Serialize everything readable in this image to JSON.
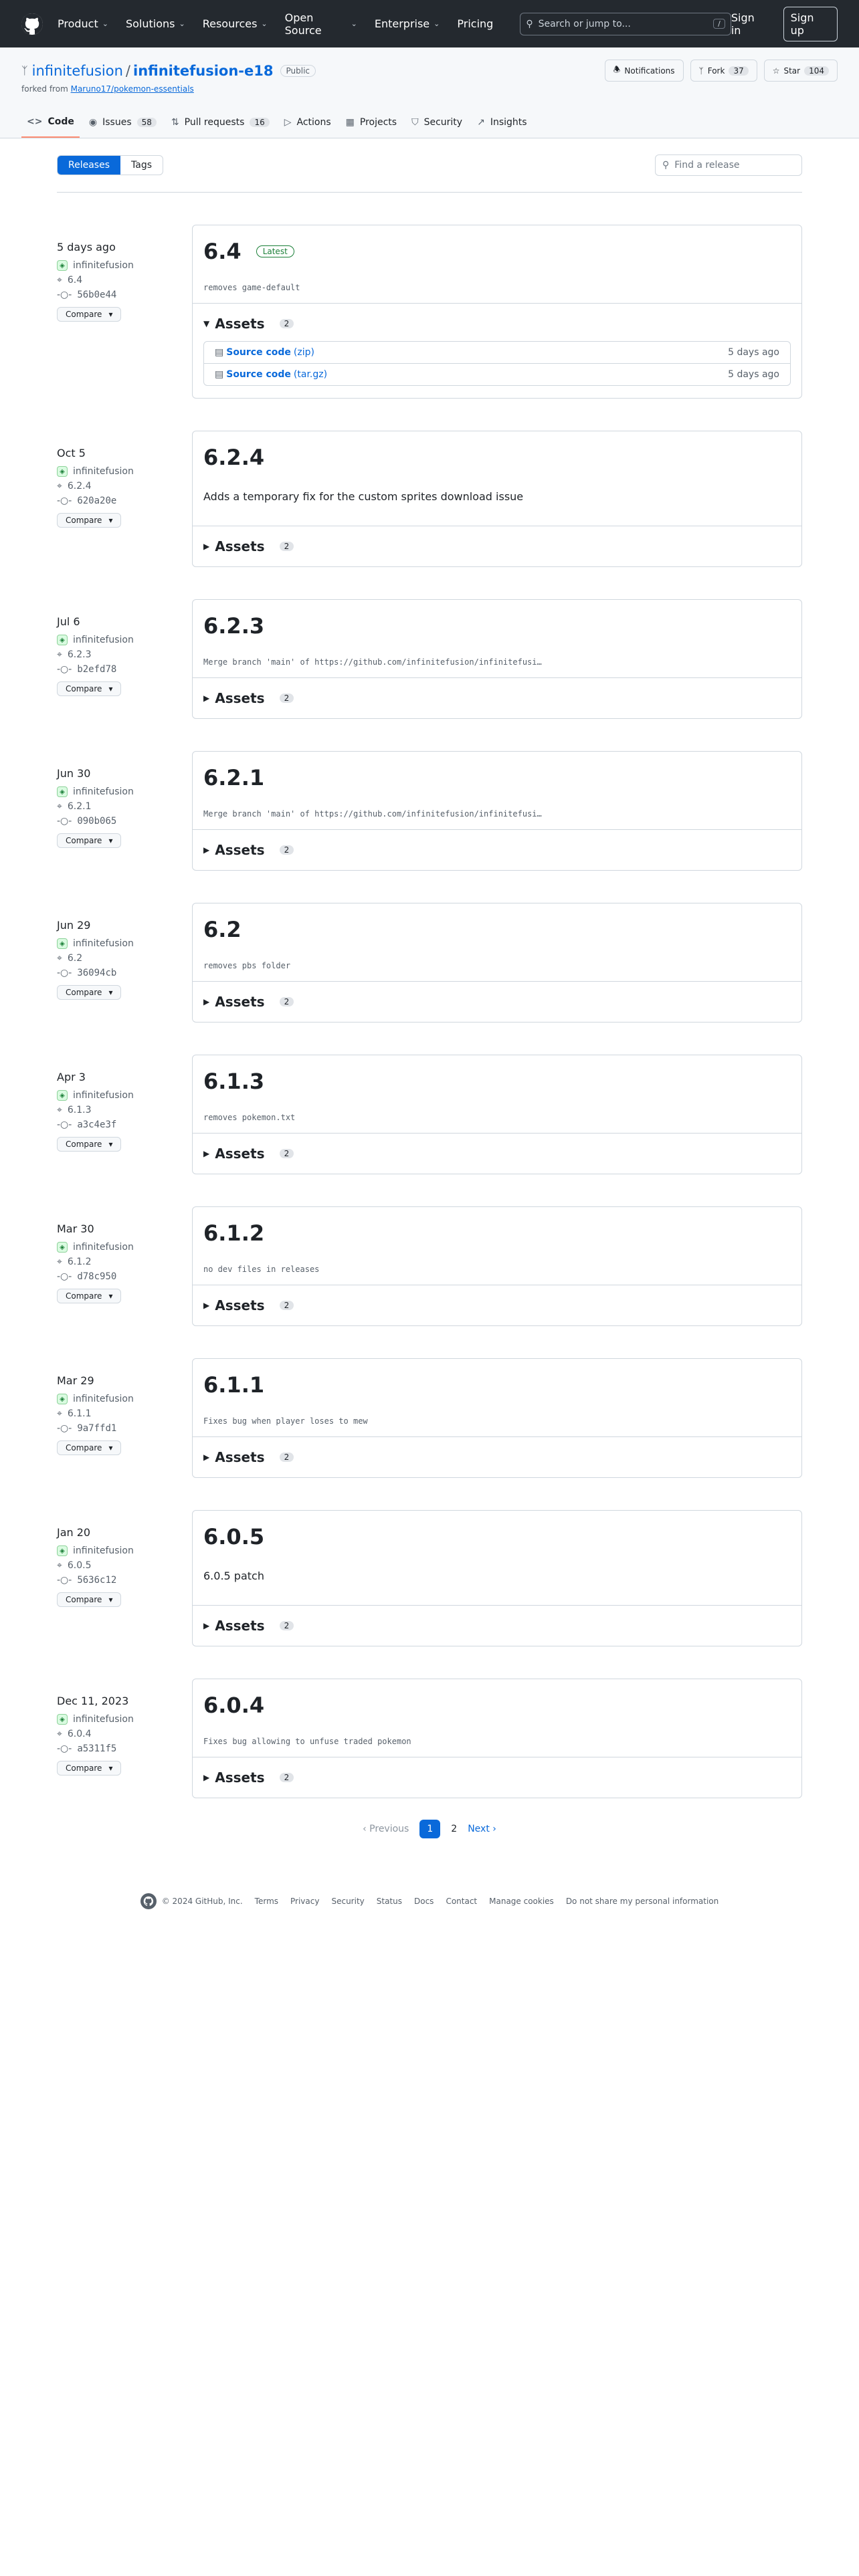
{
  "topbar": {
    "nav": [
      "Product",
      "Solutions",
      "Resources",
      "Open Source",
      "Enterprise",
      "Pricing"
    ],
    "search_placeholder": "Search or jump to...",
    "search_key": "/",
    "sign_in": "Sign in",
    "sign_up": "Sign up"
  },
  "repo": {
    "owner": "infinitefusion",
    "separator": "/",
    "name": "infinitefusion-e18",
    "visibility": "Public",
    "forked_prefix": "forked from",
    "forked_from": "Maruno17/pokemon-essentials",
    "notifications_label": "Notifications",
    "fork_label": "Fork",
    "fork_count": "37",
    "star_label": "Star",
    "star_count": "104"
  },
  "tabs": [
    {
      "label": "Code",
      "count": ""
    },
    {
      "label": "Issues",
      "count": "58"
    },
    {
      "label": "Pull requests",
      "count": "16"
    },
    {
      "label": "Actions",
      "count": ""
    },
    {
      "label": "Projects",
      "count": ""
    },
    {
      "label": "Security",
      "count": ""
    },
    {
      "label": "Insights",
      "count": ""
    }
  ],
  "switcher": {
    "releases": "Releases",
    "tags": "Tags",
    "find_placeholder": "Find a release"
  },
  "compare_label": "Compare",
  "assets_label": "Assets",
  "latest_label": "Latest",
  "releases": [
    {
      "date": "5 days ago",
      "author": "infinitefusion",
      "tag": "6.4",
      "commit": "56b0e44",
      "title": "6.4",
      "latest": true,
      "note": "removes game-default",
      "note_style": "mono",
      "assets_count": "2",
      "assets_open": true,
      "assets": [
        {
          "name": "Source code",
          "ext": "(zip)",
          "time": "5 days ago"
        },
        {
          "name": "Source code",
          "ext": "(tar.gz)",
          "time": "5 days ago"
        }
      ]
    },
    {
      "date": "Oct 5",
      "author": "infinitefusion",
      "tag": "6.2.4",
      "commit": "620a20e",
      "title": "6.2.4",
      "latest": false,
      "note": "Adds a temporary fix for the custom sprites download issue",
      "note_style": "plain",
      "assets_count": "2",
      "assets_open": false,
      "assets": []
    },
    {
      "date": "Jul 6",
      "author": "infinitefusion",
      "tag": "6.2.3",
      "commit": "b2efd78",
      "title": "6.2.3",
      "latest": false,
      "note": "Merge branch 'main' of https://github.com/infinitefusion/infinitefusi…",
      "note_style": "mono",
      "assets_count": "2",
      "assets_open": false,
      "assets": []
    },
    {
      "date": "Jun 30",
      "author": "infinitefusion",
      "tag": "6.2.1",
      "commit": "090b065",
      "title": "6.2.1",
      "latest": false,
      "note": "Merge branch 'main' of https://github.com/infinitefusion/infinitefusi…",
      "note_style": "mono",
      "assets_count": "2",
      "assets_open": false,
      "assets": []
    },
    {
      "date": "Jun 29",
      "author": "infinitefusion",
      "tag": "6.2",
      "commit": "36094cb",
      "title": "6.2",
      "latest": false,
      "note": "removes pbs folder",
      "note_style": "mono",
      "assets_count": "2",
      "assets_open": false,
      "assets": []
    },
    {
      "date": "Apr 3",
      "author": "infinitefusion",
      "tag": "6.1.3",
      "commit": "a3c4e3f",
      "title": "6.1.3",
      "latest": false,
      "note": "removes pokemon.txt",
      "note_style": "mono",
      "assets_count": "2",
      "assets_open": false,
      "assets": []
    },
    {
      "date": "Mar 30",
      "author": "infinitefusion",
      "tag": "6.1.2",
      "commit": "d78c950",
      "title": "6.1.2",
      "latest": false,
      "note": "no dev files in releases",
      "note_style": "mono",
      "assets_count": "2",
      "assets_open": false,
      "assets": []
    },
    {
      "date": "Mar 29",
      "author": "infinitefusion",
      "tag": "6.1.1",
      "commit": "9a7ffd1",
      "title": "6.1.1",
      "latest": false,
      "note": "Fixes bug when player loses to mew",
      "note_style": "mono",
      "assets_count": "2",
      "assets_open": false,
      "assets": []
    },
    {
      "date": "Jan 20",
      "author": "infinitefusion",
      "tag": "6.0.5",
      "commit": "5636c12",
      "title": "6.0.5",
      "latest": false,
      "note": "6.0.5 patch",
      "note_style": "plain",
      "assets_count": "2",
      "assets_open": false,
      "assets": []
    },
    {
      "date": "Dec 11, 2023",
      "author": "infinitefusion",
      "tag": "6.0.4",
      "commit": "a5311f5",
      "title": "6.0.4",
      "latest": false,
      "note": "Fixes bug allowing to unfuse traded pokemon",
      "note_style": "mono",
      "assets_count": "2",
      "assets_open": false,
      "assets": []
    }
  ],
  "pagination": {
    "previous": "Previous",
    "pages": [
      "1",
      "2"
    ],
    "current": "1",
    "next": "Next"
  },
  "footer": [
    "© 2024 GitHub, Inc.",
    "Terms",
    "Privacy",
    "Security",
    "Status",
    "Docs",
    "Contact",
    "Manage cookies",
    "Do not share my personal information"
  ]
}
